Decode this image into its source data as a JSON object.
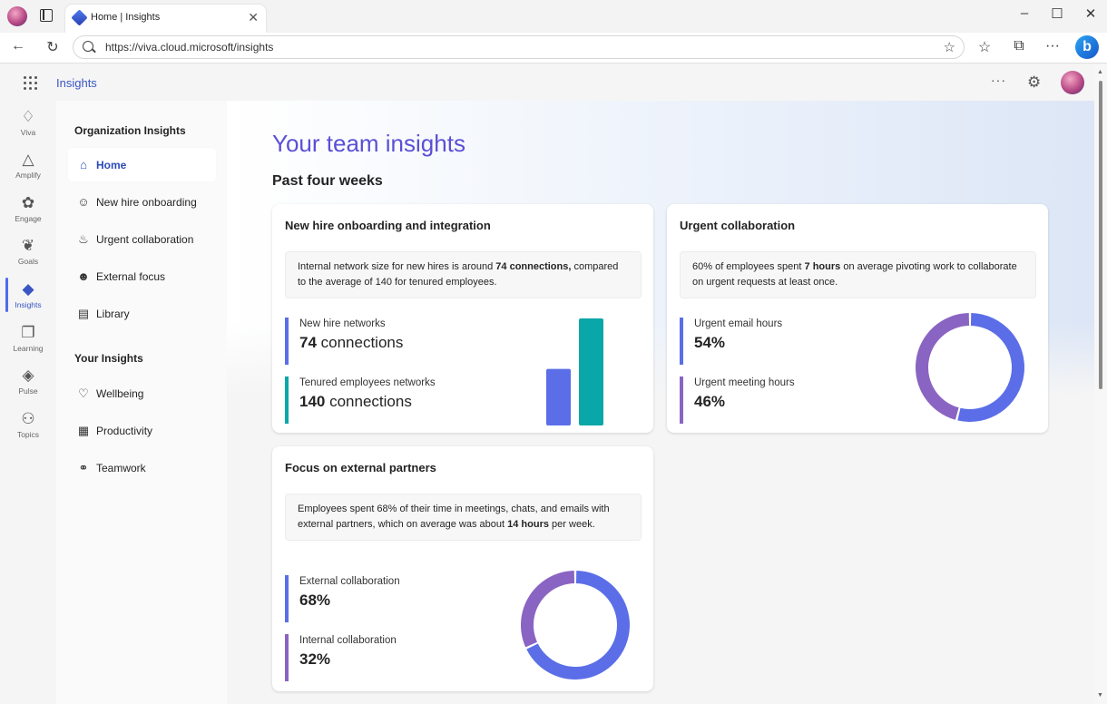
{
  "browser": {
    "tab_title": "Home | Insights",
    "url": "https://viva.cloud.microsoft/insights"
  },
  "appbar": {
    "title": "Insights",
    "more": "···"
  },
  "rail": {
    "items": [
      {
        "label": "Viva",
        "icon": "viva-icon"
      },
      {
        "label": "Amplify",
        "icon": "amplify-icon"
      },
      {
        "label": "Engage",
        "icon": "engage-icon"
      },
      {
        "label": "Goals",
        "icon": "goals-icon"
      },
      {
        "label": "Insights",
        "icon": "insights-icon"
      },
      {
        "label": "Learning",
        "icon": "learning-icon"
      },
      {
        "label": "Pulse",
        "icon": "pulse-icon"
      },
      {
        "label": "Topics",
        "icon": "topics-icon"
      }
    ]
  },
  "sidenav": {
    "org_section": "Organization Insights",
    "org_items": [
      {
        "label": "Home",
        "icon": "home-icon"
      },
      {
        "label": "New hire onboarding",
        "icon": "onboarding-icon"
      },
      {
        "label": "Urgent collaboration",
        "icon": "flame-icon"
      },
      {
        "label": "External focus",
        "icon": "external-focus-icon"
      },
      {
        "label": "Library",
        "icon": "library-icon"
      }
    ],
    "your_section": "Your Insights",
    "your_items": [
      {
        "label": "Wellbeing",
        "icon": "heart-icon"
      },
      {
        "label": "Productivity",
        "icon": "calendar-icon"
      },
      {
        "label": "Teamwork",
        "icon": "handshake-icon"
      }
    ]
  },
  "main": {
    "title": "Your team insights",
    "subtitle": "Past four weeks",
    "cards": {
      "new_hire": {
        "title": "New hire onboarding and integration",
        "desc_pre": "Internal network size for new hires is around ",
        "desc_bold": "74 connections,",
        "desc_post": " compared to the average of 140 for tenured employees.",
        "metric1_label": "New hire networks",
        "metric1_value": "74",
        "metric1_unit": " connections",
        "metric2_label": "Tenured employees networks",
        "metric2_value": "140",
        "metric2_unit": " connections"
      },
      "urgent": {
        "title": "Urgent collaboration",
        "desc_pre": "60% of employees spent ",
        "desc_bold": "7 hours",
        "desc_post": " on average pivoting work to collaborate on urgent requests at least once.",
        "metric1_label": "Urgent email hours",
        "metric1_value": "54%",
        "metric2_label": "Urgent meeting hours",
        "metric2_value": "46%"
      },
      "external": {
        "title": "Focus on external partners",
        "desc_pre": "Employees spent 68% of their time in meetings, chats, and emails with external partners, which on average was about ",
        "desc_bold": "14 hours",
        "desc_post": " per week.",
        "metric1_label": "External collaboration",
        "metric1_value": "68%",
        "metric2_label": "Internal collaboration",
        "metric2_value": "32%"
      }
    }
  },
  "colors": {
    "blue_series": "#5b6ee8",
    "teal_series": "#0aa7a8",
    "purple_series": "#8a64c2",
    "title_purple": "#5b4fd6"
  },
  "chart_data": [
    {
      "type": "bar",
      "categories": [
        "New hire networks",
        "Tenured employees networks"
      ],
      "values": [
        74,
        140
      ],
      "colors": [
        "#5b6ee8",
        "#0aa7a8"
      ]
    },
    {
      "type": "pie",
      "categories": [
        "Urgent email hours",
        "Urgent meeting hours"
      ],
      "values": [
        54,
        46
      ],
      "colors": [
        "#5b6ee8",
        "#8a64c2"
      ]
    },
    {
      "type": "pie",
      "categories": [
        "External collaboration",
        "Internal collaboration"
      ],
      "values": [
        68,
        32
      ],
      "colors": [
        "#5b6ee8",
        "#8a64c2"
      ]
    }
  ]
}
